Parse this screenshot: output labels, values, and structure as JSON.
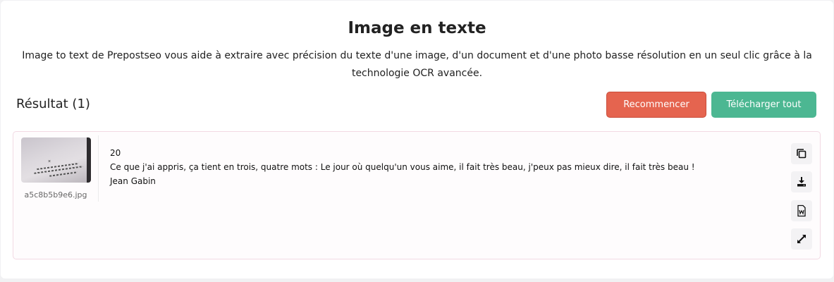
{
  "page": {
    "title": "Image en texte",
    "description": "Image to text de Prepostseo vous aide à extraire avec précision du texte d'une image, d'un document et d'une photo basse résolution en un seul clic grâce à la technologie OCR avancée."
  },
  "results": {
    "label": "Résultat (1)",
    "restart_label": "Recommencer",
    "download_all_label": "Télécharger tout",
    "items": [
      {
        "filename": "a5c8b5b9e6.jpg",
        "text_lines": [
          "20",
          "Ce que j'ai appris, ça tient en trois, quatre mots : Le jour où quelqu'un vous aime, il fait très beau, j'peux pas mieux dire, il fait très beau !",
          "Jean Gabin"
        ],
        "actions": [
          "copy-icon",
          "download-icon",
          "word-document-icon",
          "expand-icon"
        ]
      }
    ]
  },
  "colors": {
    "restart_button": "#e5644f",
    "download_button": "#4cb792"
  }
}
